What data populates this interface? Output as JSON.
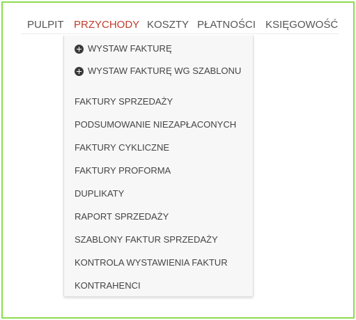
{
  "topnav": {
    "items": [
      {
        "label": "PULPIT",
        "active": false
      },
      {
        "label": "PRZYCHODY",
        "active": true
      },
      {
        "label": "KOSZTY",
        "active": false
      },
      {
        "label": "PŁATNOŚCI",
        "active": false
      },
      {
        "label": "KSIĘGOWOŚĆ",
        "active": false
      }
    ]
  },
  "dropdown": {
    "actions": [
      {
        "label": "WYSTAW FAKTURĘ",
        "icon": "plus-circle-icon"
      },
      {
        "label": "WYSTAW FAKTURĘ WG SZABLONU",
        "icon": "plus-circle-icon"
      }
    ],
    "links": [
      "FAKTURY SPRZEDAŻY",
      "PODSUMOWANIE NIEZAPŁACONYCH",
      "FAKTURY CYKLICZNE",
      "FAKTURY PROFORMA",
      "DUPLIKATY",
      "RAPORT SPRZEDAŻY",
      "SZABLONY FAKTUR SPRZEDAŻY",
      "KONTROLA WYSTAWIENIA FAKTUR",
      "KONTRAHENCI"
    ]
  },
  "colors": {
    "active_nav": "#c23a2b",
    "nav_text": "#555555",
    "frame_border": "#8bdc4f",
    "dropdown_bg": "#f7f7f7"
  }
}
